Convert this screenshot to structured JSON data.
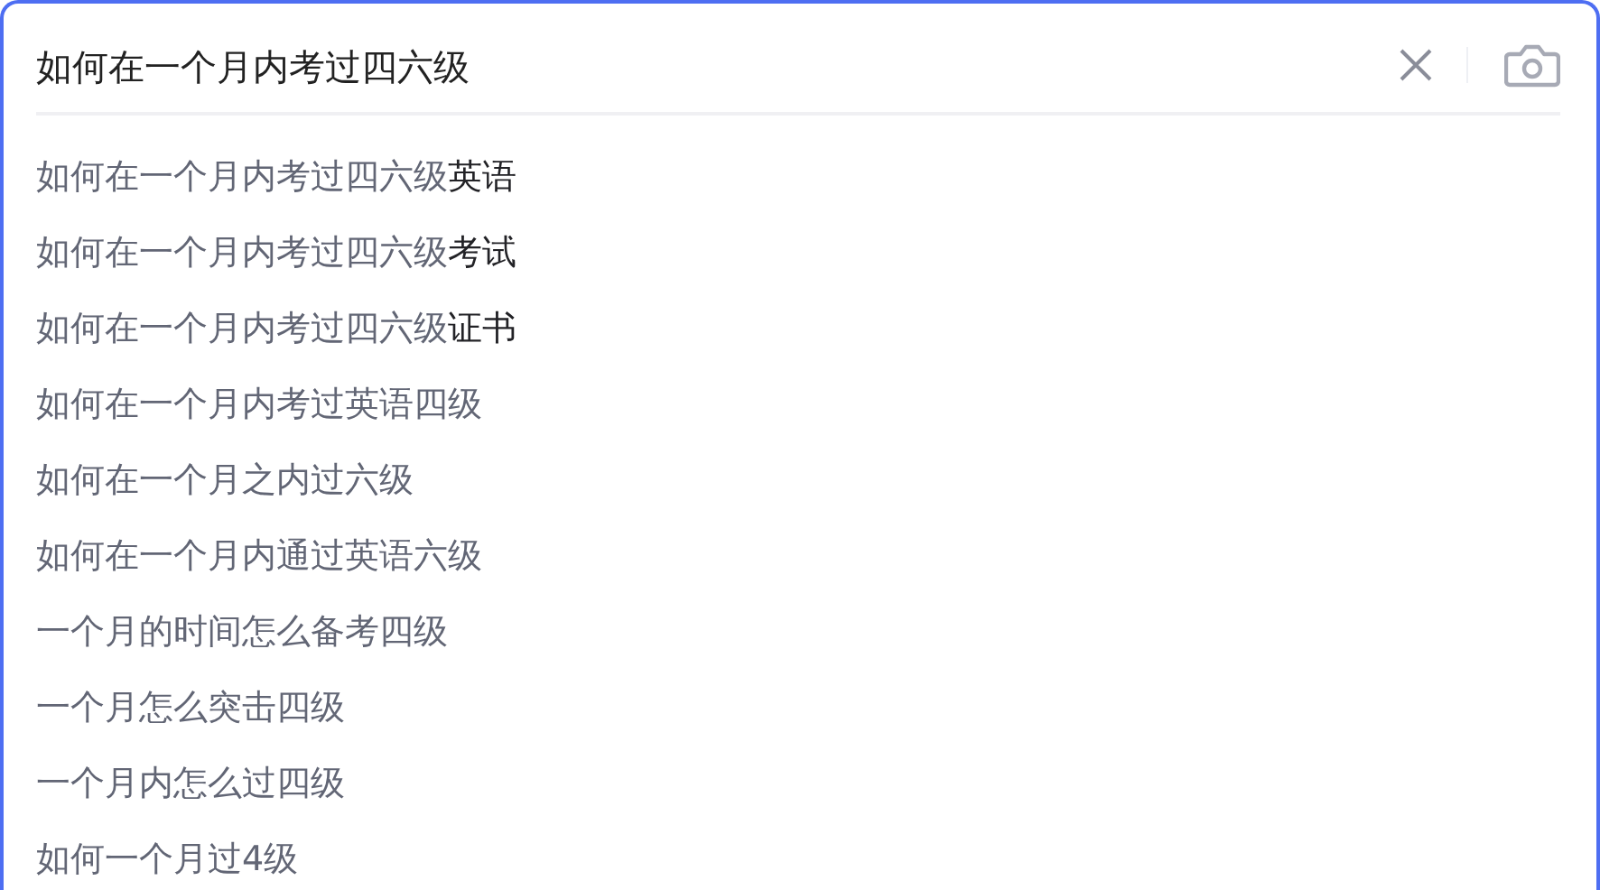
{
  "search": {
    "value": "如何在一个月内考过四六级"
  },
  "suggestions": [
    {
      "match": "如何在一个月内考过四六级",
      "rest": "英语"
    },
    {
      "match": "如何在一个月内考过四六级",
      "rest": "考试"
    },
    {
      "match": "如何在一个月内考过四六级",
      "rest": "证书"
    },
    {
      "match": "如何在一个月内考过英语四级"
    },
    {
      "match": "如何在一个月之内过六级"
    },
    {
      "match": "如何在一个月内通过英语六级"
    },
    {
      "match": "一个月的时间怎么备考四级"
    },
    {
      "match": "一个月怎么突击四级"
    },
    {
      "match": "一个月内怎么过四级"
    },
    {
      "match": "如何一个月过4级"
    }
  ]
}
